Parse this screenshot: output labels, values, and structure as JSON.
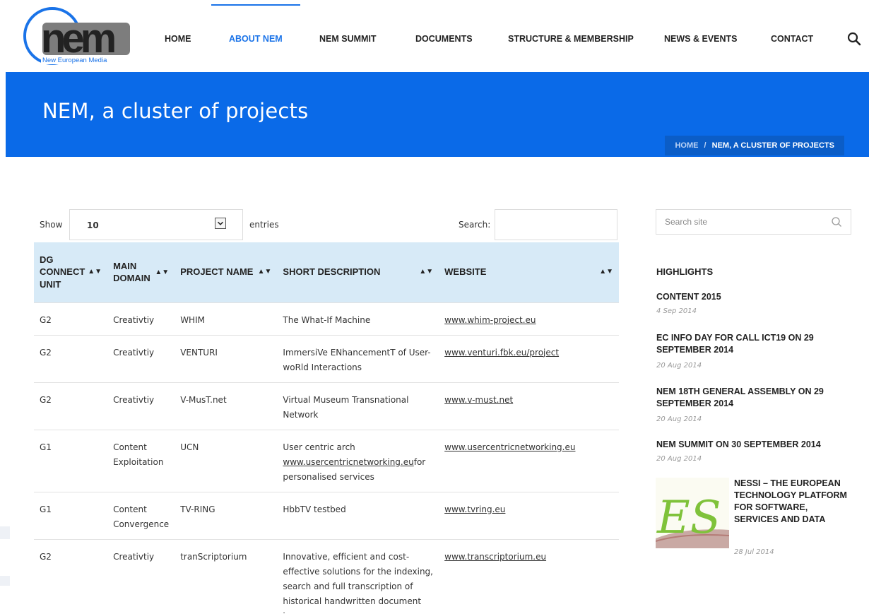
{
  "logo": {
    "text": "New European Media",
    "mark": "nem"
  },
  "nav": {
    "items": [
      {
        "label": "HOME",
        "active": false
      },
      {
        "label": "ABOUT NEM",
        "active": true
      },
      {
        "label": "NEM SUMMIT",
        "active": false
      },
      {
        "label": "DOCUMENTS",
        "active": false
      },
      {
        "label": "STRUCTURE & MEMBERSHIP",
        "active": false
      },
      {
        "label": "NEWS & EVENTS",
        "active": false
      },
      {
        "label": "CONTACT",
        "active": false
      }
    ],
    "search_icon": "search-icon",
    "accent": "#1a73e8"
  },
  "banner": {
    "title": "NEM, a cluster of projects",
    "color": "#0a6ae8",
    "breadcrumb": {
      "home": "HOME",
      "sep": "/",
      "current": "NEM, A CLUSTER OF PROJECTS"
    }
  },
  "table_controls": {
    "show_label": "Show",
    "length_value": "10",
    "entries_label": "entries",
    "search_label": "Search:",
    "search_value": ""
  },
  "table": {
    "headers": [
      "DG CONNECT UNIT",
      "MAIN DOMAIN",
      "PROJECT NAME",
      "SHORT DESCRIPTION",
      "WEBSITE"
    ],
    "header_color": "#d7eaf7",
    "rows": [
      {
        "unit": "G2",
        "domain": "Creativtiy",
        "name": "WHIM",
        "desc": "The What-If Machine",
        "desc_link": "",
        "desc_tail": "",
        "website": "www.whim-project.eu"
      },
      {
        "unit": "G2",
        "domain": "Creativtiy",
        "name": "VENTURI",
        "desc": "ImmersiVe ENhancementT of User-woRld Interactions",
        "desc_link": "",
        "desc_tail": "",
        "website": "www.venturi.fbk.eu/project"
      },
      {
        "unit": "G2",
        "domain": "Creativtiy",
        "name": "V-MusT.net",
        "desc": "Virtual Museum Transnational Network",
        "desc_link": "",
        "desc_tail": "",
        "website": "www.v-must.net"
      },
      {
        "unit": "G1",
        "domain": "Content Exploitation",
        "name": "UCN",
        "desc": "User centric arch",
        "desc_link": "www.usercentricnetworking.eu",
        "desc_tail": "for personalised services",
        "website": "www.usercentricnetworking.eu"
      },
      {
        "unit": "G1",
        "domain": "Content Convergence",
        "name": "TV-RING",
        "desc": "HbbTV testbed",
        "desc_link": "",
        "desc_tail": "",
        "website": "www.tvring.eu"
      },
      {
        "unit": "G2",
        "domain": "Creativtiy",
        "name": "tranScriptorium",
        "desc": "Innovative, efficient and cost-effective solutions for the indexing, search and full transcription of historical handwritten document images",
        "desc_link": "",
        "desc_tail": "",
        "website": "www.transcriptorium.eu"
      }
    ]
  },
  "sidebar": {
    "search_placeholder": "Search site",
    "heading": "HIGHLIGHTS",
    "items": [
      {
        "title": "CONTENT 2015",
        "date": "4 Sep 2014"
      },
      {
        "title": "EC INFO DAY FOR CALL ICT19 ON 29 SEPTEMBER 2014",
        "date": "20 Aug 2014"
      },
      {
        "title": "NEM 18TH GENERAL ASSEMBLY ON 29 SEPTEMBER 2014",
        "date": "20 Aug 2014"
      },
      {
        "title": "NEM SUMMIT ON 30 SEPTEMBER 2014",
        "date": "20 Aug 2014"
      },
      {
        "title": "NESSI – THE EUROPEAN TECHNOLOGY PLATFORM FOR SOFTWARE, SERVICES AND DATA",
        "date": "28 Jul 2014",
        "thumb_text": "ES"
      }
    ]
  }
}
